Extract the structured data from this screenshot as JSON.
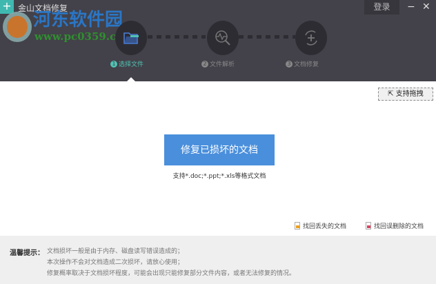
{
  "app": {
    "title": "金山文档修复",
    "login": "登录",
    "minimize": "−",
    "close": "✕",
    "icon": "+"
  },
  "watermark": {
    "name": "河东软件园",
    "url": "www.pc0359.cn"
  },
  "steps": [
    {
      "num": "1",
      "label": "选择文件"
    },
    {
      "num": "2",
      "label": "文件解析"
    },
    {
      "num": "3",
      "label": "文档修复"
    }
  ],
  "drag_label": "支持拖拽",
  "repair_button": "修复已损坏的文档",
  "support_text": "支持*.doc;*.ppt;*.xls等格式文档",
  "links": {
    "lost": "找回丢失的文档",
    "deleted": "找回误删除的文档"
  },
  "tips": {
    "label": "温馨提示：",
    "lines": [
      "文档损坏一般是由于内存、磁盘读写错误造成的；",
      "本次操作不会对文档造成二次损坏，请放心使用；",
      "修复概率取决于文档损坏程度，可能会出现只能修复部分文件内容，或者无法修复的情况。"
    ]
  },
  "colors": {
    "accent": "#4a8fdc",
    "active": "#4fc3b5",
    "header": "#434149"
  }
}
